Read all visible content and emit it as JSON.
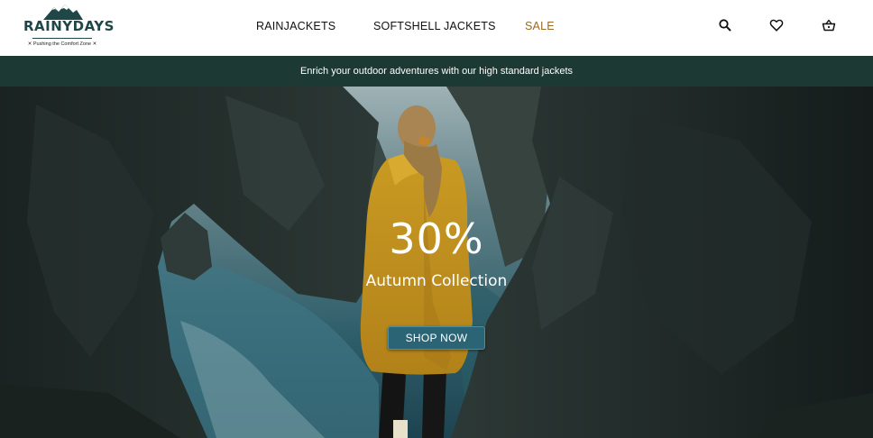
{
  "brand": {
    "name": "RAINYDAYS",
    "tagline": "✕ Pushing the Comfort Zone ✕"
  },
  "nav": {
    "items": [
      {
        "label": "RAINJACKETS"
      },
      {
        "label": "SOFTSHELL JACKETS"
      },
      {
        "label": "SALE"
      }
    ],
    "sale_color": "#9b6a22"
  },
  "header_icons": [
    "search-icon",
    "heart-icon",
    "basket-icon"
  ],
  "banner": {
    "text": "Enrich your outdoor adventures with our high standard jackets",
    "bg_color": "#1c3a33"
  },
  "hero": {
    "discount": "30%",
    "subtitle": "Autumn Collection",
    "cta_label": "SHOP NOW",
    "cta_color": "#2b6575"
  }
}
